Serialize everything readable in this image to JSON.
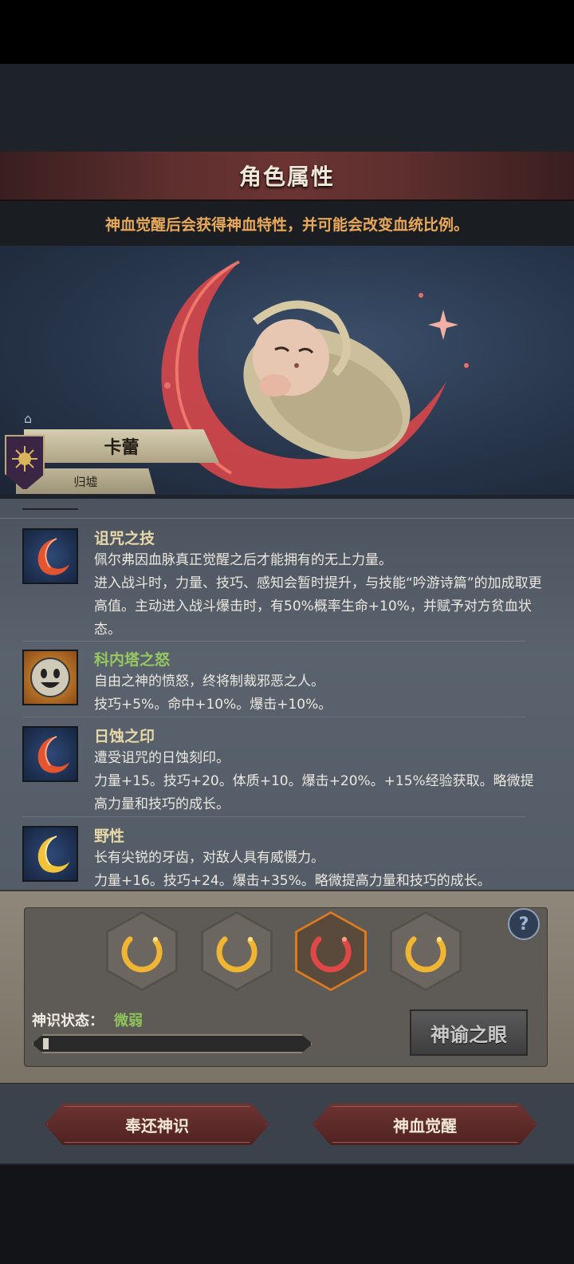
{
  "header": {
    "title": "角色属性"
  },
  "subtitle": "神血觉醒后会获得神血特性，并可能会改变血统比例。",
  "character": {
    "name": "卡蕾",
    "title": "归墟"
  },
  "traits": [
    {
      "name": "诅咒之技",
      "desc": "佩尔弗因血脉真正觉醒之后才能拥有的无上力量。\n进入战斗时，力量、技巧、感知会暂时提升，与技能“吟游诗篇”的加成取更高值。主动进入战斗爆击时，有50%概率生命+10%，并赋予对方贫血状态。",
      "icon": "crimson-moon-icon"
    },
    {
      "name": "科内塔之怒",
      "desc": "自由之神的愤怒，终将制裁邪恶之人。\n技巧+5%。命中+10%。爆击+10%。",
      "icon": "smiling-face-icon"
    },
    {
      "name": "日蚀之印",
      "desc": "遭受诅咒的日蚀刻印。\n力量+15。技巧+20。体质+10。爆击+20%。+15%经验获取。略微提高力量和技巧的成长。",
      "icon": "crimson-moon-icon"
    },
    {
      "name": "野性",
      "desc": "长有尖锐的牙齿，对敌人具有威慑力。\n力量+16。技巧+24。爆击+35%。略微提高力量和技巧的成长。",
      "icon": "golden-moon-icon"
    }
  ],
  "divine_sense": {
    "label": "神识状态：",
    "value": "微弱",
    "progress": 0.02
  },
  "slots": [
    {
      "icon": "golden-crescent-icon",
      "active": false
    },
    {
      "icon": "golden-crescent-icon",
      "active": false
    },
    {
      "icon": "red-crescent-icon",
      "active": true
    },
    {
      "icon": "golden-crescent-icon",
      "active": false
    }
  ],
  "buttons": {
    "oracle": "神谕之眼",
    "return": "奉还神识",
    "awaken": "神血觉醒",
    "help": "?"
  },
  "colors": {
    "accent_red": "#6e3332",
    "trait_green": "#97c760",
    "subtitle_orange": "#e8a95a"
  }
}
